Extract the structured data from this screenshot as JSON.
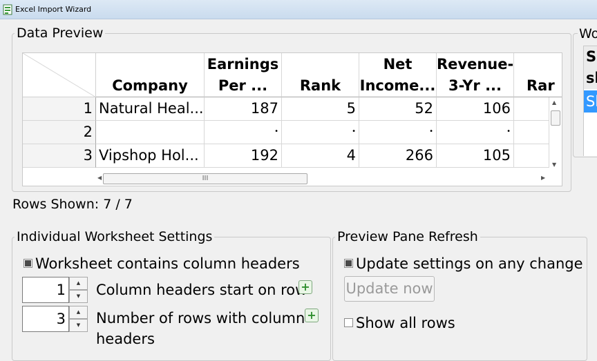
{
  "window": {
    "title": "Excel Import Wizard"
  },
  "data_preview": {
    "legend": "Data Preview",
    "columns": [
      {
        "line1": "",
        "line2": "Company"
      },
      {
        "line1": "Earnings",
        "line2": "Per ..."
      },
      {
        "line1": "",
        "line2": "Rank"
      },
      {
        "line1": "Net",
        "line2": "Income..."
      },
      {
        "line1": "Revenue-",
        "line2": "3-Yr ..."
      },
      {
        "line1": "",
        "line2": "Rar"
      }
    ],
    "rows": [
      {
        "num": "1",
        "cells": [
          "Natural Heal...",
          "187",
          "5",
          "52",
          "106",
          ""
        ]
      },
      {
        "num": "2",
        "cells": [
          "",
          "•",
          "•",
          "•",
          "•",
          ""
        ]
      },
      {
        "num": "3",
        "cells": [
          "Vipshop Hol...",
          "192",
          "4",
          "266",
          "105",
          ""
        ]
      }
    ],
    "hscroll_grip": "III"
  },
  "rows_shown": "Rows Shown: 7 / 7",
  "worksheet_settings": {
    "legend": "Individual Worksheet Settings",
    "contains_headers_label": "Worksheet contains column headers",
    "contains_headers_checked": true,
    "header_start_value": "1",
    "header_start_label": "Column headers start on row",
    "header_rows_value": "3",
    "header_rows_label_line1": "Number of rows with column",
    "header_rows_label_line2": "headers"
  },
  "preview_refresh": {
    "legend": "Preview Pane Refresh",
    "update_any_change_label": "Update settings on any change",
    "update_any_change_checked": true,
    "update_now_label": "Update now",
    "show_all_rows_label": "Show all rows",
    "show_all_rows_checked": false
  },
  "worksheets_panel": {
    "title": "Wo",
    "header_line1": "Se",
    "header_line2": "sh",
    "selected_item": "Sh"
  }
}
